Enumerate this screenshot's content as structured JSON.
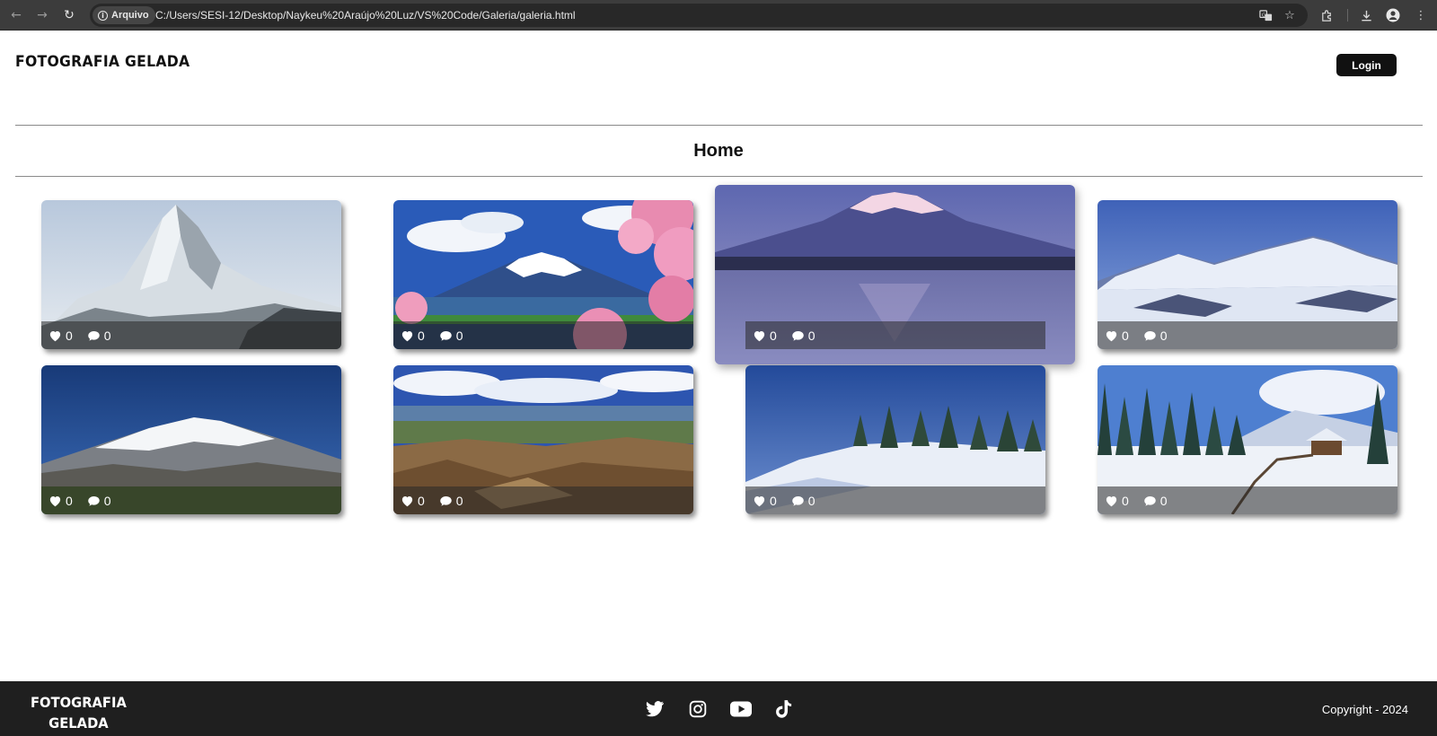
{
  "browser": {
    "chip_label": "Arquivo",
    "url": "C:/Users/SESI-12/Desktop/Naykeu%20Araújo%20Luz/VS%20Code/Galeria/galeria.html",
    "icons": [
      "back-icon",
      "forward-icon",
      "reload-icon",
      "info-icon",
      "translate-icon",
      "star-icon",
      "extensions-icon",
      "download-icon",
      "profile-icon",
      "menu-icon"
    ]
  },
  "header": {
    "brand": "FOTOGRAFIA GELADA",
    "login_label": "Login"
  },
  "page": {
    "title": "Home"
  },
  "gallery": [
    {
      "scene": "snowy-peak",
      "likes": "0",
      "comments": "0"
    },
    {
      "scene": "mount-fuji-cherry-blossoms",
      "likes": "0",
      "comments": "0"
    },
    {
      "scene": "mount-fuji-lake-reflection",
      "likes": "0",
      "comments": "0"
    },
    {
      "scene": "snowy-mountain-range",
      "likes": "0",
      "comments": "0"
    },
    {
      "scene": "snow-capped-volcano",
      "likes": "0",
      "comments": "0"
    },
    {
      "scene": "rocky-plateau",
      "likes": "0",
      "comments": "0"
    },
    {
      "scene": "snowy-hill-pines",
      "likes": "0",
      "comments": "0"
    },
    {
      "scene": "snowy-forest-cabin",
      "likes": "0",
      "comments": "0"
    }
  ],
  "footer": {
    "brand_line1": "FOTOGRAFIA",
    "brand_line2": "GELADA",
    "social": [
      "twitter-icon",
      "instagram-icon",
      "youtube-icon",
      "tiktok-icon"
    ],
    "copyright": "Copyright - 2024"
  },
  "colors": {
    "dark": "#111111",
    "footer_bg": "#1f1f1f",
    "chrome_bg": "#3c3c3c",
    "divider": "#8a8a8a"
  }
}
